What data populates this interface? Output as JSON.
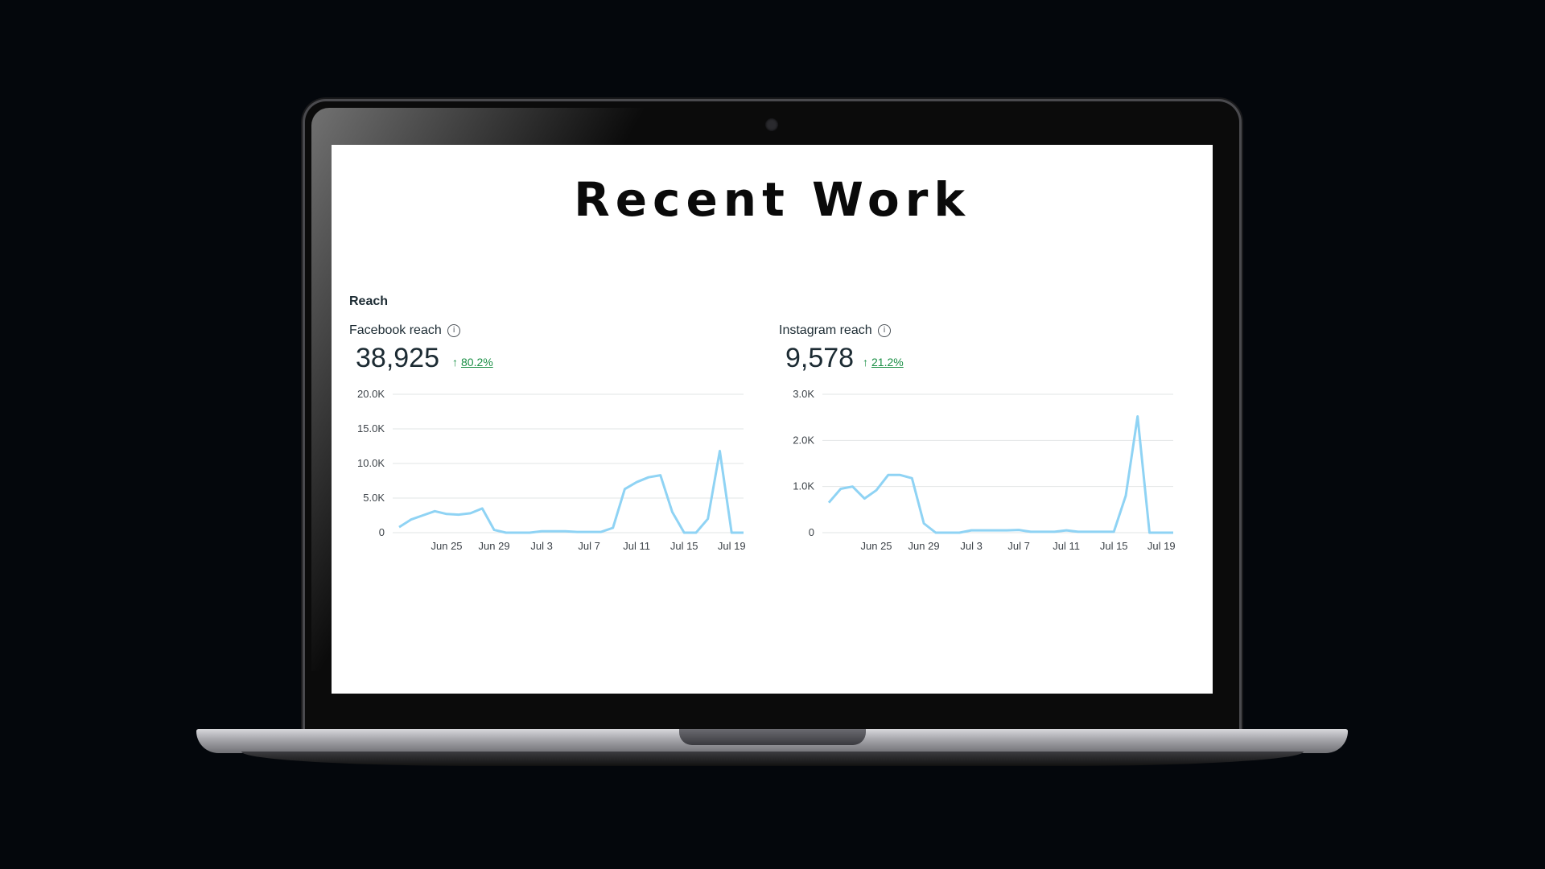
{
  "page": {
    "title": "Recent Work"
  },
  "section_label": "Reach",
  "panels": [
    {
      "label": "Facebook reach",
      "value": "38,925",
      "delta": "80.2%"
    },
    {
      "label": "Instagram reach",
      "value": "9,578",
      "delta": "21.2%"
    }
  ],
  "colors": {
    "line": "#8fd3f4",
    "grid": "#e2e4e6",
    "delta": "#1a8f45"
  },
  "chart_data": [
    {
      "type": "line",
      "title": "Facebook reach",
      "x_ticks": [
        "Jun 25",
        "Jun 29",
        "Jul 3",
        "Jul 7",
        "Jul 11",
        "Jul 15",
        "Jul 19"
      ],
      "y_ticks": [
        "0",
        "5.0K",
        "10.0K",
        "15.0K",
        "20.0K"
      ],
      "ylim": [
        0,
        20000
      ],
      "x": [
        "Jun 21",
        "Jun 22",
        "Jun 23",
        "Jun 24",
        "Jun 25",
        "Jun 26",
        "Jun 27",
        "Jun 28",
        "Jun 29",
        "Jun 30",
        "Jul 1",
        "Jul 2",
        "Jul 3",
        "Jul 4",
        "Jul 5",
        "Jul 6",
        "Jul 7",
        "Jul 8",
        "Jul 9",
        "Jul 10",
        "Jul 11",
        "Jul 12",
        "Jul 13",
        "Jul 14",
        "Jul 15",
        "Jul 16",
        "Jul 17",
        "Jul 18",
        "Jul 19",
        "Jul 20"
      ],
      "series": [
        {
          "values": [
            800,
            1900,
            2500,
            3100,
            2700,
            2600,
            2800,
            3500,
            400,
            0,
            0,
            0,
            200,
            200,
            200,
            100,
            100,
            100,
            700,
            6300,
            7300,
            8000,
            8300,
            3000,
            0,
            0,
            2000,
            11800,
            0,
            0
          ]
        }
      ],
      "grid": true
    },
    {
      "type": "line",
      "title": "Instagram reach",
      "x_ticks": [
        "Jun 25",
        "Jun 29",
        "Jul 3",
        "Jul 7",
        "Jul 11",
        "Jul 15",
        "Jul 19"
      ],
      "y_ticks": [
        "0",
        "1.0K",
        "2.0K",
        "3.0K"
      ],
      "ylim": [
        0,
        3000
      ],
      "x": [
        "Jun 21",
        "Jun 22",
        "Jun 23",
        "Jun 24",
        "Jun 25",
        "Jun 26",
        "Jun 27",
        "Jun 28",
        "Jun 29",
        "Jun 30",
        "Jul 1",
        "Jul 2",
        "Jul 3",
        "Jul 4",
        "Jul 5",
        "Jul 6",
        "Jul 7",
        "Jul 8",
        "Jul 9",
        "Jul 10",
        "Jul 11",
        "Jul 12",
        "Jul 13",
        "Jul 14",
        "Jul 15",
        "Jul 16",
        "Jul 17",
        "Jul 18",
        "Jul 19",
        "Jul 20"
      ],
      "series": [
        {
          "values": [
            650,
            950,
            1000,
            740,
            920,
            1250,
            1250,
            1180,
            200,
            0,
            0,
            0,
            50,
            50,
            50,
            50,
            60,
            20,
            20,
            20,
            50,
            20,
            20,
            20,
            20,
            800,
            2520,
            0,
            0,
            0
          ]
        }
      ],
      "grid": true
    }
  ]
}
